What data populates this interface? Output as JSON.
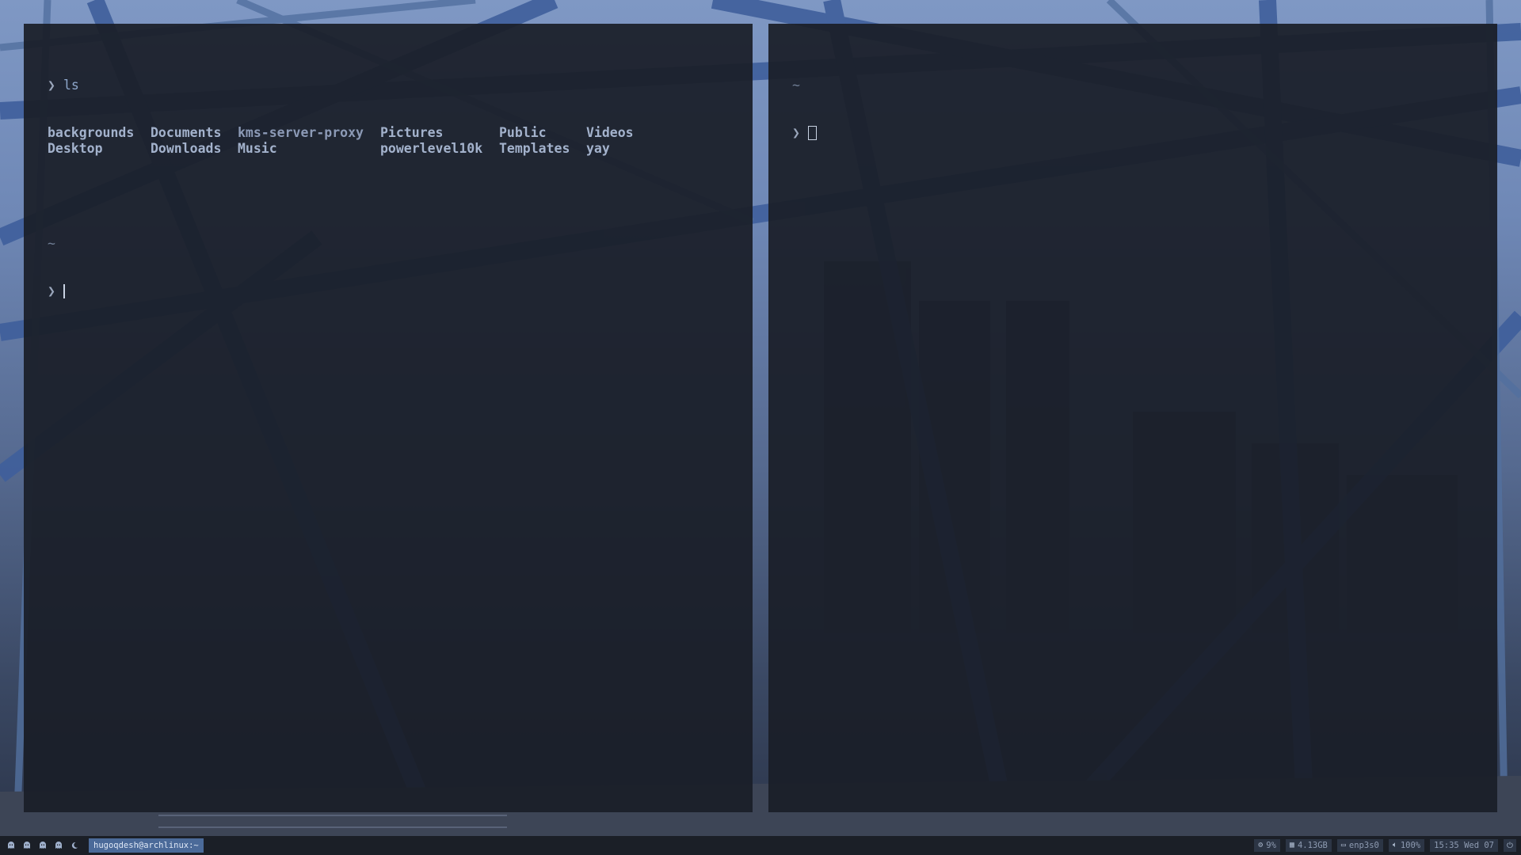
{
  "terminal_left": {
    "line1_prompt": "❯",
    "line1_cmd": "ls",
    "ls_output": [
      "backgrounds",
      "Documents",
      "kms-server-proxy",
      "Pictures",
      "Public",
      "Videos",
      "Desktop",
      "Downloads",
      "Music",
      "powerlevel10k",
      "Templates",
      "yay"
    ],
    "cwd": "~",
    "prompt": "❯"
  },
  "terminal_right": {
    "cwd": "~",
    "prompt": "❯"
  },
  "statusbar": {
    "workspaces": [
      "ghost-icon",
      "ghost-icon",
      "ghost-icon",
      "ghost-icon",
      "moon-icon"
    ],
    "window_title": "hugoqdesh@archlinux:~",
    "cpu": "9%",
    "memory": "4.13GB",
    "network": "enp3s0",
    "volume": "100%",
    "clock": "15:35 Wed 07",
    "icons": {
      "cpu": "gear-icon",
      "memory": "memory-icon",
      "network": "network-icon",
      "volume": "speaker-icon",
      "power": "power-icon"
    }
  },
  "colors": {
    "accent": "#4b6a99",
    "terminal_bg": "#1a1e28",
    "bar_bg": "#1b1f27"
  }
}
